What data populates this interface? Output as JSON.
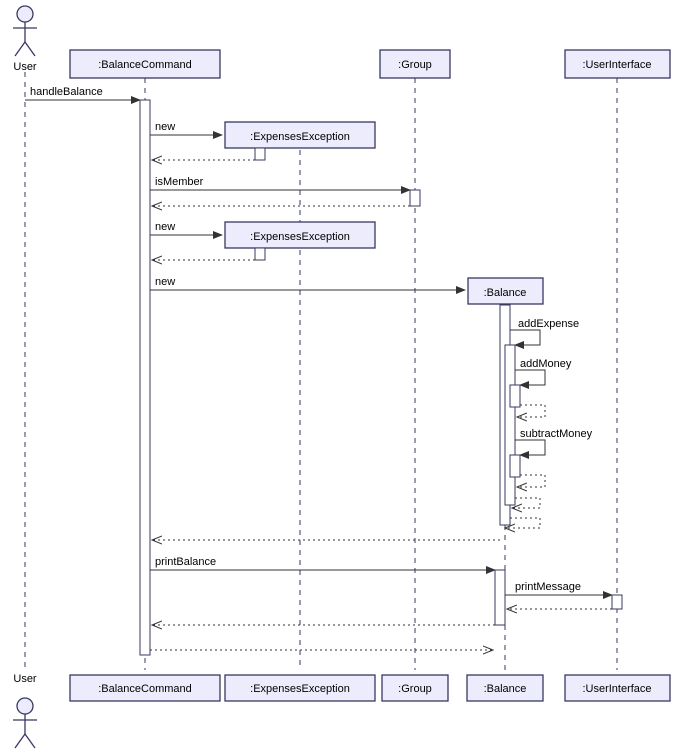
{
  "actor": "User",
  "participants": {
    "p1": ":BalanceCommand",
    "p2": ":ExpensesException",
    "p3": ":Group",
    "p4": ":Balance",
    "p5": ":UserInterface"
  },
  "footer_labels": {
    "actor": "User",
    "p1": ":BalanceCommand",
    "p2": ":ExpensesException",
    "p3": ":Group",
    "p4": ":Balance",
    "p5": ":UserInterface"
  },
  "messages": {
    "m1": "handleBalance",
    "m2": "new",
    "m3": "isMember",
    "m4": "new",
    "m5": "new",
    "m6": "addExpense",
    "m7": "addMoney",
    "m8": "subtractMoney",
    "m9": "printBalance",
    "m10": "printMessage"
  },
  "chart_data": {
    "type": "sequence-diagram",
    "actor": "User",
    "participants": [
      ":BalanceCommand",
      ":ExpensesException",
      ":Group",
      ":Balance",
      ":UserInterface"
    ],
    "interactions": [
      {
        "from": "User",
        "to": ":BalanceCommand",
        "label": "handleBalance",
        "kind": "call"
      },
      {
        "from": ":BalanceCommand",
        "to": ":ExpensesException",
        "label": "new",
        "kind": "create"
      },
      {
        "from": ":ExpensesException",
        "to": ":BalanceCommand",
        "label": "",
        "kind": "return"
      },
      {
        "from": ":BalanceCommand",
        "to": ":Group",
        "label": "isMember",
        "kind": "call"
      },
      {
        "from": ":Group",
        "to": ":BalanceCommand",
        "label": "",
        "kind": "return"
      },
      {
        "from": ":BalanceCommand",
        "to": ":ExpensesException",
        "label": "new",
        "kind": "create"
      },
      {
        "from": ":ExpensesException",
        "to": ":BalanceCommand",
        "label": "",
        "kind": "return"
      },
      {
        "from": ":BalanceCommand",
        "to": ":Balance",
        "label": "new",
        "kind": "create"
      },
      {
        "from": ":Balance",
        "to": ":Balance",
        "label": "addExpense",
        "kind": "self"
      },
      {
        "from": ":Balance",
        "to": ":Balance",
        "label": "addMoney",
        "kind": "self"
      },
      {
        "from": ":Balance",
        "to": ":Balance",
        "label": "",
        "kind": "return"
      },
      {
        "from": ":Balance",
        "to": ":Balance",
        "label": "subtractMoney",
        "kind": "self"
      },
      {
        "from": ":Balance",
        "to": ":Balance",
        "label": "",
        "kind": "return"
      },
      {
        "from": ":Balance",
        "to": ":Balance",
        "label": "",
        "kind": "return"
      },
      {
        "from": ":Balance",
        "to": ":BalanceCommand",
        "label": "",
        "kind": "return"
      },
      {
        "from": ":BalanceCommand",
        "to": ":Balance",
        "label": "printBalance",
        "kind": "call"
      },
      {
        "from": ":Balance",
        "to": ":UserInterface",
        "label": "printMessage",
        "kind": "call"
      },
      {
        "from": ":UserInterface",
        "to": ":Balance",
        "label": "",
        "kind": "return"
      },
      {
        "from": ":Balance",
        "to": ":BalanceCommand",
        "label": "",
        "kind": "return"
      },
      {
        "from": ":BalanceCommand",
        "to": ":Balance",
        "label": "",
        "kind": "return"
      }
    ]
  }
}
